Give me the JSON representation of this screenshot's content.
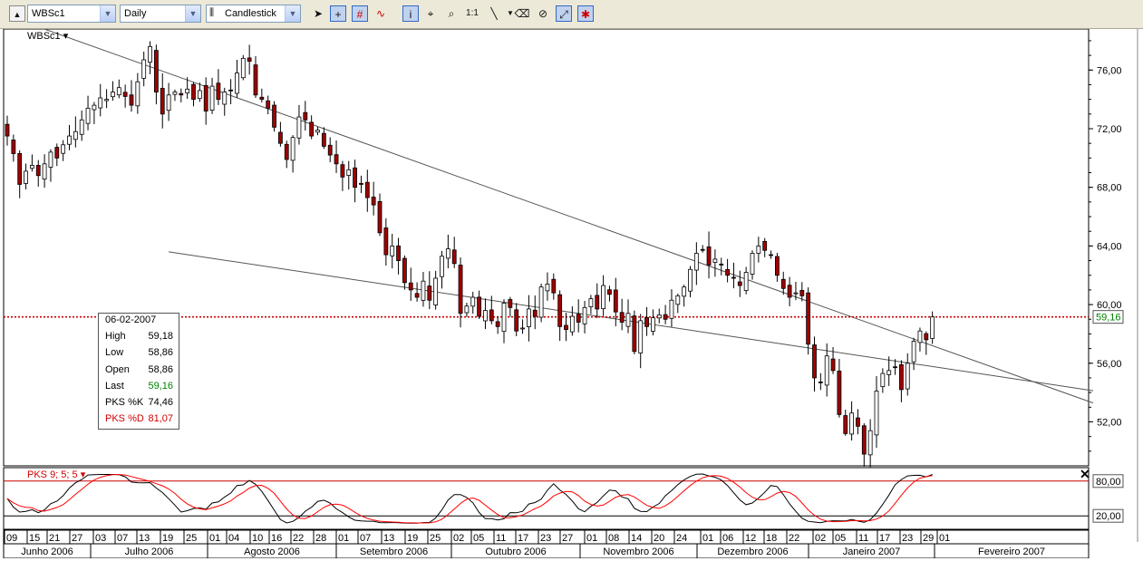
{
  "toolbar": {
    "symbol": "WBSc1",
    "period": "Daily",
    "chart_style": "Candlestick",
    "tools": [
      "scroll-up-icon",
      "pointer-icon",
      "crosshair-icon",
      "delete-icon",
      "indicator-icon",
      "info-icon",
      "zoom-area-icon",
      "zoom-icon",
      "one-to-one-icon",
      "line-tool-icon",
      "dropdown-icon",
      "eraser-icon",
      "erase-all-icon",
      "auto-scale-icon",
      "color-icon"
    ]
  },
  "chart": {
    "symbol_label": "WBSc1",
    "last_price_label": "59,16",
    "indicator_title": "PKS 9; 5; 5",
    "indicator_levels": [
      "80,00",
      "20,00"
    ]
  },
  "info": {
    "date": "06-02-2007",
    "rows": [
      {
        "label": "High",
        "value": "59,18"
      },
      {
        "label": "Low",
        "value": "58,86"
      },
      {
        "label": "Open",
        "value": "58,86"
      },
      {
        "label": "Last",
        "value": "59,16"
      },
      {
        "label": "PKS %K",
        "value": "74,46"
      },
      {
        "label": "PKS %D",
        "value": "81,07"
      }
    ]
  },
  "colors": {
    "up": "#ffffff",
    "down": "#a00000",
    "last_line": "#cc0000",
    "k_line": "#000000",
    "d_line": "#ff0000",
    "green_text": "#008000"
  },
  "chart_data": {
    "type": "candlestick",
    "yticks": [
      "76,00",
      "72,00",
      "68,00",
      "64,00",
      "60,00",
      "56,00",
      "52,00"
    ],
    "ylim": [
      49.0,
      78.8
    ],
    "x_day_labels": [
      "09",
      "15",
      "21",
      "27",
      "03",
      "07",
      "13",
      "19",
      "25",
      "01",
      "04",
      "10",
      "16",
      "22",
      "28",
      "01",
      "07",
      "13",
      "19",
      "25",
      "02",
      "05",
      "11",
      "17",
      "23",
      "27",
      "01",
      "08",
      "14",
      "20",
      "24",
      "01",
      "06",
      "12",
      "18",
      "22",
      "02",
      "05",
      "11",
      "17",
      "23",
      "29",
      "01"
    ],
    "months": [
      "Junho 2006",
      "Julho 2006",
      "Agosto 2006",
      "Setembro 2006",
      "Outubro 2006",
      "Novembro 2006",
      "Dezembro 2006",
      "Janeiro 2007",
      "Fevereiro 2007"
    ],
    "last_price": 59.16,
    "trend_lines": [
      {
        "from": [
          0.0,
          79.7
        ],
        "to": [
          147.0,
          57.5
        ]
      },
      {
        "from": [
          26.0,
          63.6
        ],
        "to": [
          147.0,
          55.9
        ]
      }
    ],
    "close": [
      71.5,
      70.3,
      68.2,
      69.1,
      69.5,
      68.8,
      69.6,
      70.4,
      70.0,
      70.9,
      71.5,
      71.8,
      72.6,
      73.4,
      73.6,
      74.1,
      74.0,
      74.5,
      74.8,
      74.2,
      73.6,
      75.2,
      76.7,
      77.6,
      74.5,
      73.0,
      74.3,
      74.5,
      74.3,
      74.7,
      74.0,
      74.6,
      73.2,
      74.9,
      74.0,
      74.5,
      74.6,
      75.8,
      76.8,
      76.6,
      74.3,
      74.0,
      73.4,
      72.1,
      71.0,
      69.9,
      71.4,
      72.8,
      72.6,
      71.5,
      71.9,
      70.8,
      70.2,
      69.6,
      68.7,
      69.2,
      68.0,
      68.2,
      67.3,
      66.8,
      64.9,
      63.4,
      64.0,
      63.0,
      61.5,
      61.0,
      60.5,
      61.6,
      60.3,
      61.8,
      63.3,
      63.8,
      62.8,
      59.4,
      59.9,
      60.5,
      59.2,
      59.6,
      58.9,
      58.5,
      60.1,
      59.8,
      58.2,
      58.4,
      59.7,
      59.2,
      61.2,
      61.4,
      60.8,
      58.5,
      58.3,
      59.2,
      58.8,
      59.8,
      60.4,
      59.7,
      61.3,
      60.7,
      59.5,
      58.8,
      59.4,
      56.8,
      58.9,
      58.5,
      59.1,
      59.3,
      59.0,
      60.3,
      60.6,
      61.2,
      62.4,
      63.5,
      63.7,
      62.7,
      63.1,
      62.7,
      62.0,
      61.8,
      61.3,
      62.2,
      63.5,
      64.0,
      63.7,
      63.4,
      62.0,
      61.1,
      60.5,
      60.8,
      60.6,
      57.3,
      55.0,
      54.7,
      56.5,
      55.5,
      52.5,
      51.2,
      52.6,
      51.7,
      49.8,
      51.4,
      54.1,
      55.3,
      55.5,
      55.7,
      54.2,
      56.0,
      57.5,
      58.2,
      57.6,
      59.16
    ],
    "indicator": {
      "name": "PKS 9; 5; 5",
      "k_value": 74.46,
      "d_value": 81.07,
      "levels": [
        80,
        20
      ],
      "ylim": [
        0,
        100
      ]
    }
  }
}
